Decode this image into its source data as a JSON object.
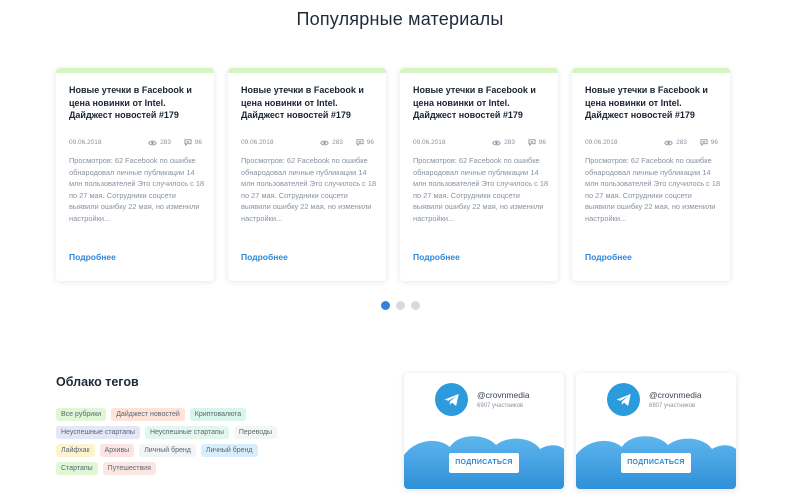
{
  "section": {
    "title": "Популярные материалы"
  },
  "cards": [
    {
      "title": "Новые утечки в Facebook и цена новинки от Intel. Дайджест новостей #179",
      "date": "09.06.2018",
      "views": "283",
      "comments": "96",
      "excerpt": "Просмотров: 62 Facebook по ошибке обнародовал личные публикации 14 млн пользователей Это случилось с 18 по 27 мая. Сотрудники соцсети выявили ошибку 22 мая, но изменили настройки...",
      "more": "Подробнее"
    },
    {
      "title": "Новые утечки в Facebook и цена новинки от Intel. Дайджест новостей #179",
      "date": "09.06.2018",
      "views": "283",
      "comments": "96",
      "excerpt": "Просмотров: 62 Facebook по ошибке обнародовал личные публикации 14 млн пользователей Это случилось с 18 по 27 мая. Сотрудники соцсети выявили ошибку 22 мая, но изменили настройки...",
      "more": "Подробнее"
    },
    {
      "title": "Новые утечки в Facebook и цена новинки от Intel. Дайджест новостей #179",
      "date": "09.06.2018",
      "views": "283",
      "comments": "96",
      "excerpt": "Просмотров: 62 Facebook по ошибке обнародовал личные публикации 14 млн пользователей Это случилось с 18 по 27 мая. Сотрудники соцсети выявили ошибку 22 мая, но изменили настройки...",
      "more": "Подробнее"
    },
    {
      "title": "Новые утечки в Facebook и цена новинки от Intel. Дайджест новостей #179",
      "date": "09.06.2018",
      "views": "283",
      "comments": "96",
      "excerpt": "Просмотров: 62 Facebook по ошибке обнародовал личные публикации 14 млн пользователей Это случилось с 18 по 27 мая. Сотрудники соцсети выявили ошибку 22 мая, но изменили настройки...",
      "more": "Подробнее"
    }
  ],
  "slider": {
    "active_index": 0,
    "count": 3
  },
  "tags": {
    "title": "Облако тегов",
    "rows": [
      [
        {
          "label": "Все рубрики",
          "color": "#dff7d4"
        },
        {
          "label": "Дайджест новостей",
          "color": "#fde3d8"
        },
        {
          "label": "Криптовалюта",
          "color": "#d8f6ea"
        }
      ],
      [
        {
          "label": "Неуспешные стартапы",
          "color": "#e4e8f6"
        },
        {
          "label": "Неуспешные стартапы",
          "color": "#e3f7ee"
        },
        {
          "label": "Переводы",
          "color": "#f3f7f3"
        }
      ],
      [
        {
          "label": "Лайфхак",
          "color": "#fbf4cf"
        },
        {
          "label": "Архивы",
          "color": "#fde3e3"
        },
        {
          "label": "Личный бренд",
          "color": "#f3f4f6"
        },
        {
          "label": "Личный бренд",
          "color": "#d9eefb"
        }
      ],
      [
        {
          "label": "Стартапы",
          "color": "#dff7d4"
        },
        {
          "label": "Путешествия",
          "color": "#fbe6e2"
        }
      ]
    ]
  },
  "telegram": [
    {
      "icon": "telegram-icon",
      "handle": "@crovnmedia",
      "members": "6907 участников",
      "button": "ПОДПИСАТЬСЯ"
    },
    {
      "icon": "telegram-icon",
      "handle": "@crovnmedia",
      "members": "6907 участников",
      "button": "ПОДПИСАТЬСЯ"
    }
  ],
  "colors": {
    "accent": "#2f86d6",
    "card_top": "#d7f5c2",
    "telegram": "#2c9bde"
  }
}
